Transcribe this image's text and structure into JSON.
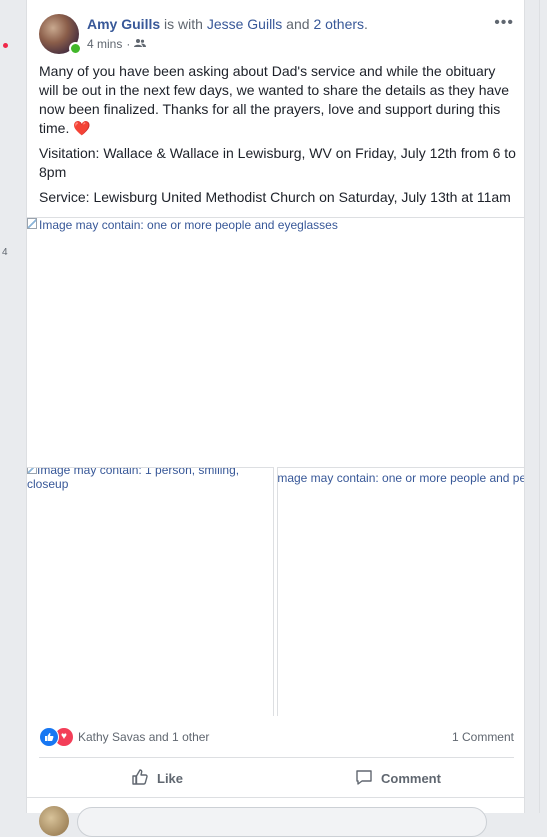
{
  "sidebar": {
    "counter": "4"
  },
  "post": {
    "author": "Amy Guills",
    "with_text": " is with ",
    "tagged": "Jesse Guills",
    "and_text": " and ",
    "others": "2 others",
    "period": ".",
    "time": "4 mins",
    "separator": "·",
    "privacy_icon": "friends-icon",
    "more_label": "•••",
    "paragraph1": "Many of you have been asking about Dad's service and while the obituary will be out in the next few days, we wanted to share the details as they have now been finalized. Thanks for all the prayers, love and support during this time.",
    "heart_emoji": "❤️",
    "paragraph2": "Visitation: Wallace & Wallace in Lewisburg, WV on Friday, July 12th from 6 to 8pm",
    "paragraph3": "Service: Lewisburg United Methodist Church on Saturday, July 13th at 11am"
  },
  "photos": {
    "main_alt": "Image may contain: one or more people and eyeglasses",
    "left_alt": "Image may contain: 1 person, smiling, closeup",
    "right_alt": "Image may contain: one or more people and people smiling"
  },
  "reactions": {
    "like_icon": "thumbs-up-icon",
    "love_icon": "heart-icon",
    "names": "Kathy Savas and 1 other",
    "comment_count": "1 Comment"
  },
  "actions": {
    "like_label": "Like",
    "comment_label": "Comment"
  },
  "colors": {
    "link": "#385898",
    "like_blue": "#1877f2",
    "love_red": "#f33e58",
    "online_green": "#42b72a"
  }
}
